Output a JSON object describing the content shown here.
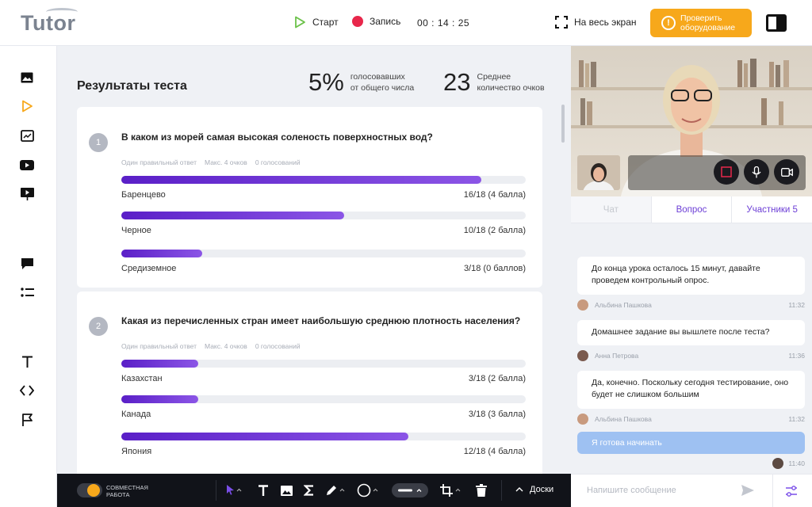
{
  "header": {
    "logo": "Tutor",
    "start_label": "Старт",
    "record_label": "Запись",
    "timer": "00 : 14 : 25",
    "fullscreen_label": "На весь экран",
    "check_label_line1": "Проверить",
    "check_label_line2": "оборудование",
    "accent": "#f7a81b",
    "record_color": "#e8274b"
  },
  "sidebar": {
    "icons": [
      "image-icon",
      "play-icon",
      "chart-icon",
      "video-icon",
      "presentation-icon",
      "comment-icon",
      "list-icon",
      "text-icon",
      "code-icon",
      "flag-icon"
    ]
  },
  "results": {
    "title": "Результаты теста",
    "percent_value": "5%",
    "percent_label_1": "голосовавших",
    "percent_label_2": "от общего числа",
    "avg_value": "23",
    "avg_label_1": "Среднее",
    "avg_label_2": "количество очков"
  },
  "questions": [
    {
      "number": "1",
      "text": "В каком из морей самая высокая соленость поверхностных вод?",
      "meta": [
        "Один правильный ответ",
        "Макс. 4 очков",
        "0 голосований"
      ],
      "options": [
        {
          "label": "Баренцево",
          "result": "16/18 (4 балла)",
          "share": 0.89
        },
        {
          "label": "Черное",
          "result": "10/18 (2 балла)",
          "share": 0.55
        },
        {
          "label": "Средиземное",
          "result": "3/18 (0 баллов)",
          "share": 0.2
        }
      ]
    },
    {
      "number": "2",
      "text": "Какая из перечисленных стран имеет наибольшую среднюю плотность населения?",
      "meta": [
        "Один правильный ответ",
        "Макс. 4 очков",
        "0 голосований"
      ],
      "options": [
        {
          "label": "Казахстан",
          "result": "3/18 (2 балла)",
          "share": 0.19
        },
        {
          "label": "Канада",
          "result": "3/18 (3 балла)",
          "share": 0.19
        },
        {
          "label": "Япония",
          "result": "12/18 (4 балла)",
          "share": 0.71
        }
      ]
    }
  ],
  "bottom_toolbar": {
    "collab_line1": "Совместная",
    "collab_line2": "работа",
    "tools": [
      "cursor-icon",
      "text-tool-icon",
      "image-tool-icon",
      "sigma-icon",
      "pen-icon",
      "circle-icon",
      "line-icon",
      "crop-icon",
      "trash-icon"
    ],
    "boards_label": "Доски"
  },
  "right_panel": {
    "tabs": [
      "Чат",
      "Вопрос",
      "Участники 5"
    ],
    "messages": [
      {
        "text": "До конца урока осталось 15 минут, давайте проведем контрольный опрос.",
        "author": "Альбина Пашкова",
        "time": "11:32"
      },
      {
        "text": "Домашнее задание вы вышлете после теста?",
        "author": "Анна Петрова",
        "time": "11:36"
      },
      {
        "text": "Да, конечно. Поскольку сегодня тестирование, оно будет не слишком большим",
        "author": "Альбина Пашкова",
        "time": "11:32"
      },
      {
        "text": "Я готова начинать",
        "author": "",
        "time": "11:40"
      }
    ],
    "input_placeholder": "Напишите сообщение"
  }
}
